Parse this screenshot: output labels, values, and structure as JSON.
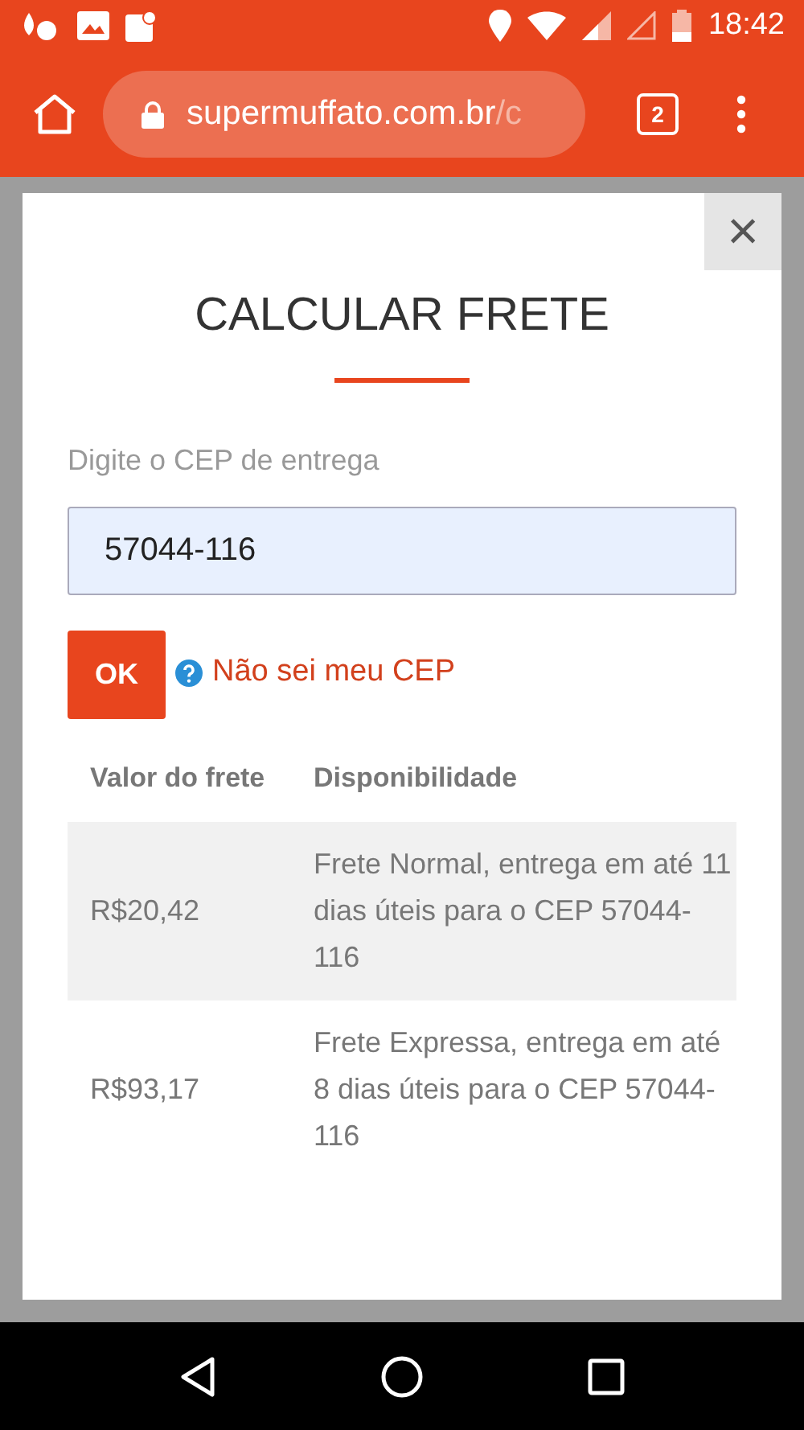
{
  "status_bar": {
    "time": "18:42"
  },
  "browser": {
    "url_host": "supermuffato.com.br",
    "url_path": "/c",
    "tab_count": "2"
  },
  "modal": {
    "title": "CALCULAR FRETE",
    "close_label": "×",
    "field_label": "Digite o CEP de entrega",
    "cep_value": "57044-116",
    "ok_label": "OK",
    "help_link": "Não sei meu CEP",
    "table": {
      "columns": [
        "Valor do frete",
        "Disponibilidade"
      ],
      "rows": [
        {
          "price": "R$20,42",
          "availability": "Frete Normal, entrega em até 11 dias úteis para o CEP 57044-116",
          "shaded": true
        },
        {
          "price": "R$93,17",
          "availability": "Frete Expressa, entrega em até 8 dias úteis para o CEP 57044-116",
          "shaded": false
        }
      ]
    }
  }
}
